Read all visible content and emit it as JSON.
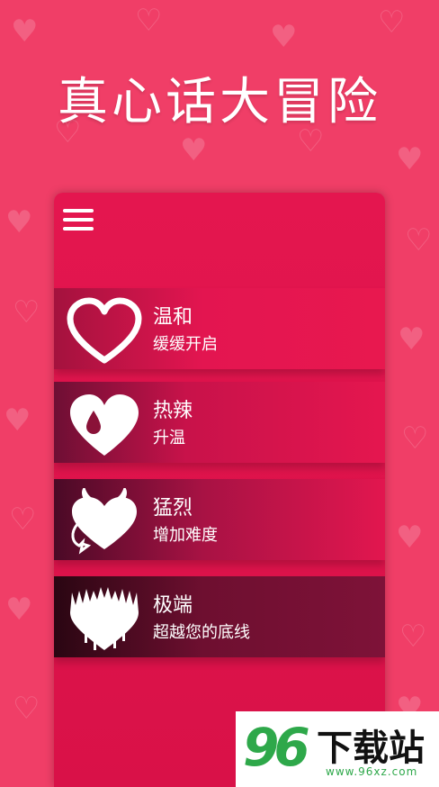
{
  "app": {
    "title": "真心话大冒险"
  },
  "menu": {
    "icon": "hamburger-menu-icon"
  },
  "modes": [
    {
      "name": "温和",
      "desc": "缓缓开启",
      "icon": "outline-heart-icon"
    },
    {
      "name": "热辣",
      "desc": "升温",
      "icon": "heart-drop-icon"
    },
    {
      "name": "猛烈",
      "desc": "增加难度",
      "icon": "devil-heart-icon"
    },
    {
      "name": "极端",
      "desc": "超越您的底线",
      "icon": "dripping-heart-icon"
    }
  ],
  "watermark": {
    "number": "96",
    "text": "下载站",
    "url": "www.96xz.com"
  },
  "colors": {
    "background": "#f03e67",
    "panel": "#e4164f",
    "watermark_green": "#2ea84a"
  }
}
